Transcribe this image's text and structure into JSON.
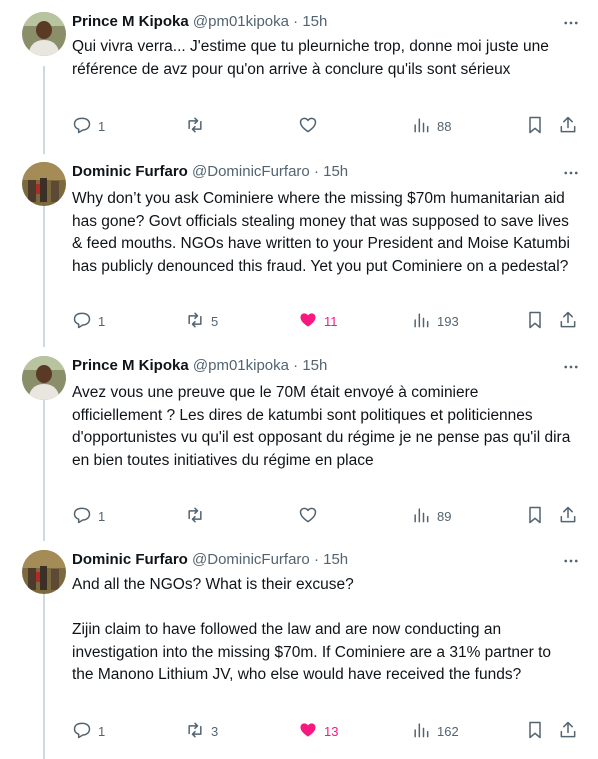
{
  "tweets": [
    {
      "name": "Prince M Kipoka",
      "handle": "@pm01kipoka",
      "time": "15h",
      "text": "Qui vivra verra... J'estime que tu pleurniche trop, donne moi juste une référence de avz pour qu'on arrive à conclure qu'ils sont sérieux",
      "replies": "1",
      "reposts": "",
      "likes": "",
      "views": "88",
      "liked": false
    },
    {
      "name": "Dominic Furfaro",
      "handle": "@DominicFurfaro",
      "time": "15h",
      "text": "Why don’t you ask Cominiere where the missing $70m humanitarian aid has gone? Govt officials stealing money that was supposed to save lives & feed mouths. NGOs have written to your President and Moise Katumbi has publicly denounced this fraud. Yet you put Cominiere on a pedestal?",
      "replies": "1",
      "reposts": "5",
      "likes": "11",
      "views": "193",
      "liked": true
    },
    {
      "name": "Prince M Kipoka",
      "handle": "@pm01kipoka",
      "time": "15h",
      "text": "Avez vous une preuve que le 70M était envoyé à cominiere officiellement ? Les dires de katumbi sont politiques et politiciennes d'opportunistes vu qu'il est opposant du régime je ne pense pas qu'il dira en bien toutes initiatives du régime en place",
      "replies": "1",
      "reposts": "",
      "likes": "",
      "views": "89",
      "liked": false
    },
    {
      "name": "Dominic Furfaro",
      "handle": "@DominicFurfaro",
      "time": "15h",
      "text": "And all the NGOs? What is their excuse?\n\nZijin claim to have followed the law and are now conducting an investigation into the missing $70m. If Cominiere are a 31% partner to the Manono Lithium JV, who else would have received the funds?",
      "replies": "1",
      "reposts": "3",
      "likes": "13",
      "views": "162",
      "liked": true
    }
  ],
  "separator": "·",
  "icons": {
    "reply": "reply-icon",
    "repost": "repost-icon",
    "like": "heart-icon",
    "views": "views-icon",
    "bookmark": "bookmark-icon",
    "share": "share-icon",
    "more": "more-icon"
  },
  "colors": {
    "text": "#0f1419",
    "muted": "#536471",
    "like": "#f91880",
    "thread_line": "#cfd9de"
  }
}
